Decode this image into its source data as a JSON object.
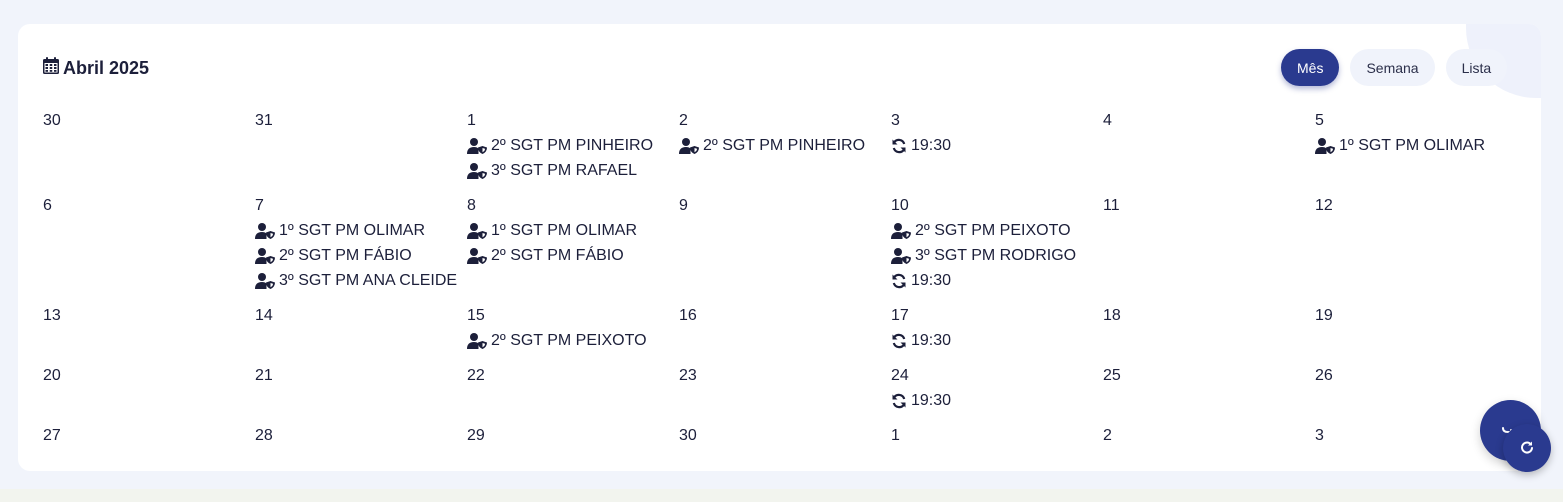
{
  "header": {
    "title": "Abril 2025",
    "icon": "calendar-icon"
  },
  "views": [
    {
      "label": "Mês",
      "active": true
    },
    {
      "label": "Semana",
      "active": false
    },
    {
      "label": "Lista",
      "active": false
    }
  ],
  "weeks": [
    [
      {
        "day": "30",
        "events": []
      },
      {
        "day": "31",
        "events": []
      },
      {
        "day": "1",
        "events": [
          {
            "icon": "user-shield-icon",
            "text": "2º SGT PM PINHEIRO"
          },
          {
            "icon": "user-shield-icon",
            "text": "3º SGT PM RAFAEL"
          }
        ]
      },
      {
        "day": "2",
        "events": [
          {
            "icon": "user-shield-icon",
            "text": "2º SGT PM PINHEIRO"
          }
        ]
      },
      {
        "day": "3",
        "events": [
          {
            "icon": "sync-icon",
            "text": "19:30"
          }
        ]
      },
      {
        "day": "4",
        "events": []
      },
      {
        "day": "5",
        "events": [
          {
            "icon": "user-shield-icon",
            "text": "1º SGT PM OLIMAR"
          }
        ]
      }
    ],
    [
      {
        "day": "6",
        "events": []
      },
      {
        "day": "7",
        "events": [
          {
            "icon": "user-shield-icon",
            "text": "1º SGT PM OLIMAR"
          },
          {
            "icon": "user-shield-icon",
            "text": "2º SGT PM FÁBIO"
          },
          {
            "icon": "user-shield-icon",
            "text": "3º SGT PM ANA CLEIDE"
          }
        ]
      },
      {
        "day": "8",
        "events": [
          {
            "icon": "user-shield-icon",
            "text": "1º SGT PM OLIMAR"
          },
          {
            "icon": "user-shield-icon",
            "text": "2º SGT PM FÁBIO"
          }
        ]
      },
      {
        "day": "9",
        "events": []
      },
      {
        "day": "10",
        "events": [
          {
            "icon": "user-shield-icon",
            "text": "2º SGT PM PEIXOTO"
          },
          {
            "icon": "user-shield-icon",
            "text": "3º SGT PM RODRIGO"
          },
          {
            "icon": "sync-icon",
            "text": "19:30"
          }
        ]
      },
      {
        "day": "11",
        "events": []
      },
      {
        "day": "12",
        "events": []
      }
    ],
    [
      {
        "day": "13",
        "events": []
      },
      {
        "day": "14",
        "events": []
      },
      {
        "day": "15",
        "events": [
          {
            "icon": "user-shield-icon",
            "text": "2º SGT PM PEIXOTO"
          }
        ]
      },
      {
        "day": "16",
        "events": []
      },
      {
        "day": "17",
        "events": [
          {
            "icon": "sync-icon",
            "text": "19:30"
          }
        ]
      },
      {
        "day": "18",
        "events": []
      },
      {
        "day": "19",
        "events": []
      }
    ],
    [
      {
        "day": "20",
        "events": []
      },
      {
        "day": "21",
        "events": []
      },
      {
        "day": "22",
        "events": []
      },
      {
        "day": "23",
        "events": []
      },
      {
        "day": "24",
        "events": [
          {
            "icon": "sync-icon",
            "text": "19:30"
          }
        ]
      },
      {
        "day": "25",
        "events": []
      },
      {
        "day": "26",
        "events": []
      }
    ],
    [
      {
        "day": "27",
        "events": []
      },
      {
        "day": "28",
        "events": []
      },
      {
        "day": "29",
        "events": []
      },
      {
        "day": "30",
        "events": []
      },
      {
        "day": "1",
        "events": []
      },
      {
        "day": "2",
        "events": []
      },
      {
        "day": "3",
        "events": []
      }
    ]
  ],
  "fab": {
    "main_icon": "phone-icon",
    "sub_icon": "refresh-icon"
  },
  "colors": {
    "accent": "#2a3a8f",
    "text": "#1c1f3a",
    "page_bg": "#f1f4fb"
  }
}
